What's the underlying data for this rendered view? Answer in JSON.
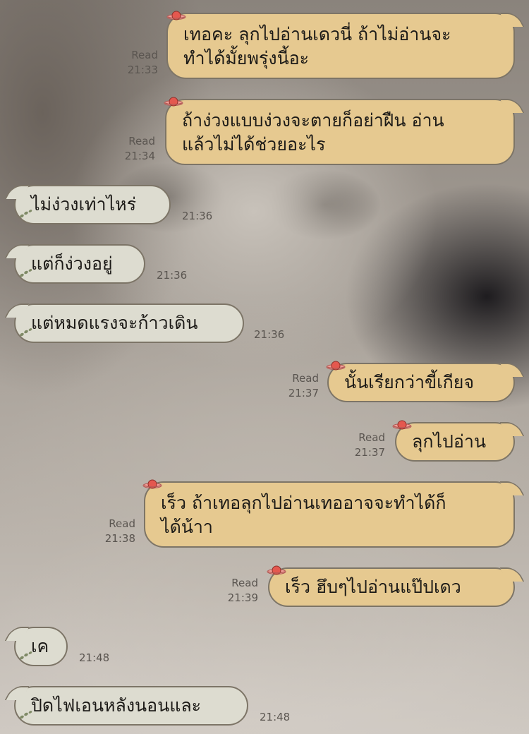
{
  "colors": {
    "sent_bubble": "#e6c990",
    "received_bubble": "#dddcd0",
    "bubble_border": "#7d7567",
    "meta_text": "#5a5550"
  },
  "decor": {
    "sent_sticker": "planet-icon",
    "received_sticker": "leaf-dots-icon"
  },
  "messages": [
    {
      "side": "sent",
      "lines": [
        "เทอคะ ลุกไปอ่านเดวนี่ ถ้าไม่อ่านจะ",
        "ทำได้มั้ยพรุ่งนี้อะ"
      ],
      "status": "Read",
      "time": "21:33"
    },
    {
      "side": "sent",
      "lines": [
        "ถ้าง่วงแบบง่วงจะตายก็อย่าฝืน อ่าน",
        "แล้วไม่ได้ช่วยอะไร"
      ],
      "status": "Read",
      "time": "21:34"
    },
    {
      "side": "received",
      "lines": [
        "ไม่ง่วงเท่าไหร่"
      ],
      "time": "21:36"
    },
    {
      "side": "received",
      "lines": [
        "แต่ก็ง่วงอยู่"
      ],
      "time": "21:36"
    },
    {
      "side": "received",
      "lines": [
        "แต่หมดแรงจะก้าวเดิน"
      ],
      "time": "21:36"
    },
    {
      "side": "sent",
      "lines": [
        "นั้นเรียกว่าขี้เกียจ"
      ],
      "status": "Read",
      "time": "21:37"
    },
    {
      "side": "sent",
      "lines": [
        "ลุกไปอ่าน"
      ],
      "status": "Read",
      "time": "21:37"
    },
    {
      "side": "sent",
      "lines": [
        "เร็ว ถ้าเทอลุกไปอ่านเทออาจจะทำได้ก็",
        "ได้น้าา"
      ],
      "status": "Read",
      "time": "21:38"
    },
    {
      "side": "sent",
      "lines": [
        "เร็ว ฮึบๆไปอ่านแป๊ปเดว"
      ],
      "status": "Read",
      "time": "21:39"
    },
    {
      "side": "received",
      "lines": [
        "เค"
      ],
      "time": "21:48"
    },
    {
      "side": "received",
      "lines": [
        "ปิดไฟเอนหลังนอนและ"
      ],
      "time": "21:48"
    }
  ]
}
